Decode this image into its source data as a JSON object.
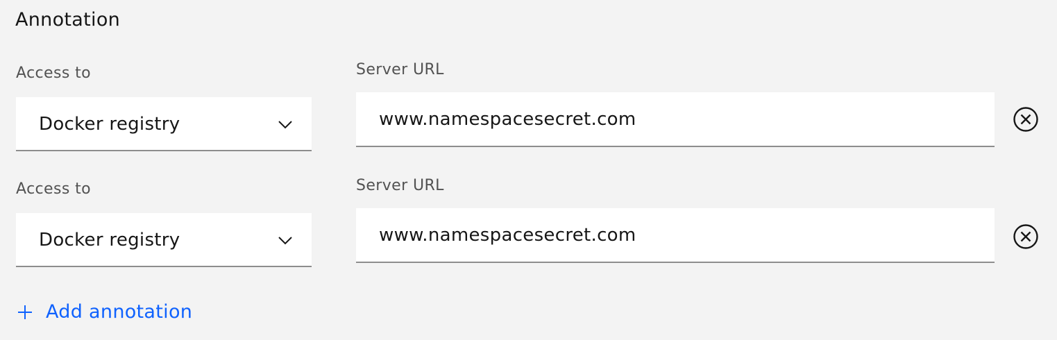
{
  "section": {
    "title": "Annotation"
  },
  "rows": [
    {
      "access_label": "Access to",
      "access_value": "Docker registry",
      "url_label": "Server URL",
      "url_value": "www.namespacesecret.com"
    },
    {
      "access_label": "Access to",
      "access_value": "Docker registry",
      "url_label": "Server URL",
      "url_value": "www.namespacesecret.com"
    }
  ],
  "actions": {
    "add_label": "Add annotation"
  },
  "icons": {
    "chevron": "chevron-down-icon",
    "remove": "close-circle-icon",
    "add": "plus-icon"
  },
  "colors": {
    "background": "#f3f3f3",
    "field_background": "#ffffff",
    "link": "#0f62fe",
    "text": "#161616",
    "label": "#525252",
    "border": "#8d8d8d"
  }
}
